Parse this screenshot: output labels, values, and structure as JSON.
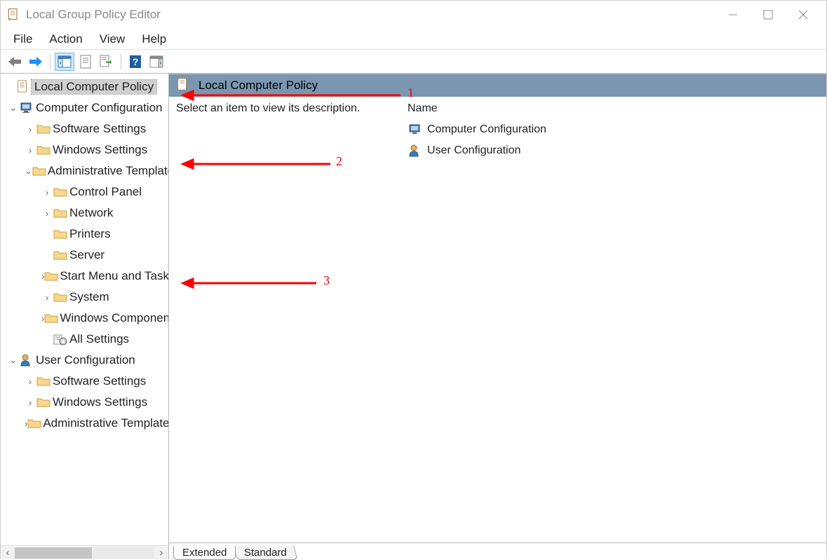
{
  "window": {
    "title": "Local Group Policy Editor"
  },
  "menu": {
    "items": [
      "File",
      "Action",
      "View",
      "Help"
    ]
  },
  "toolbar": {
    "back": "back",
    "forward": "forward",
    "up": "up-level",
    "properties": "properties",
    "export": "export",
    "help": "help",
    "showhide": "show-hide"
  },
  "tree": {
    "root": "Local Computer Policy",
    "computer": "Computer Configuration",
    "computer_children": {
      "software": "Software Settings",
      "windows": "Windows Settings",
      "admin": "Administrative Templates",
      "admin_children": {
        "control_panel": "Control Panel",
        "network": "Network",
        "printers": "Printers",
        "server": "Server",
        "start_menu": "Start Menu and Taskbar",
        "system": "System",
        "windows_components": "Windows Components",
        "all_settings": "All Settings"
      }
    },
    "user": "User Configuration",
    "user_children": {
      "software": "Software Settings",
      "windows": "Windows Settings",
      "admin": "Administrative Templates"
    }
  },
  "detail": {
    "heading": "Local Computer Policy",
    "description": "Select an item to view its description.",
    "column_header": "Name",
    "items": [
      "Computer Configuration",
      "User Configuration"
    ]
  },
  "tabs": {
    "extended": "Extended",
    "standard": "Standard"
  },
  "annotations": {
    "a1": "1",
    "a2": "2",
    "a3": "3"
  }
}
